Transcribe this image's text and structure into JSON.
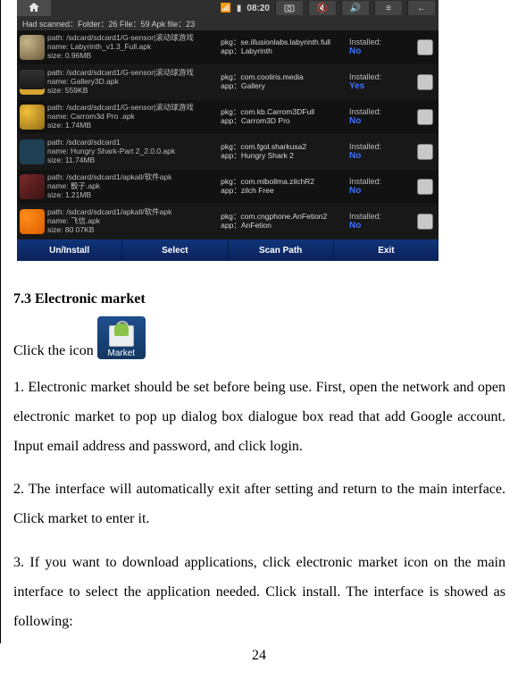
{
  "device": {
    "statusbar": {
      "home_icon": "home-icon",
      "time": "08:20"
    },
    "scan_header": "Had scanned：Folder：26  File：59  Apk file：23",
    "apks": [
      {
        "path": "path: /sdcard/sdcard1/G-sensor|滚动球游戏",
        "name": "name: Labyrinth_v1.3_Full.apk",
        "size": "size: 0.96MB",
        "pkg": "pkg：se.illusionlabs.labyrinth.full",
        "app": "app：Labyrinth",
        "installed_label": "Installed:",
        "status": "No"
      },
      {
        "path": "path: /sdcard/sdcard1/G-sensor|滚动球游戏",
        "name": "name: Gallery3D.apk",
        "size": "size: 559KB",
        "pkg": "pkg：com.cooliris.media",
        "app": "app：Gallery",
        "installed_label": "Installed:",
        "status": "Yes"
      },
      {
        "path": "path: /sdcard/sdcard1/G-sensor|滚动球游戏",
        "name": "name: Carrom3d Pro .apk",
        "size": "size: 1.74MB",
        "pkg": "pkg：com.kb.Carrom3DFull",
        "app": "app：Carrom3D Pro",
        "installed_label": "Installed:",
        "status": "No"
      },
      {
        "path": "path: /sdcard/sdcard1",
        "name": "name: Hungry Shark-Part 2_2.0.0.apk",
        "size": "size: 11.74MB",
        "pkg": "pkg：com.fgol.sharkusa2",
        "app": "app：Hungry Shark 2",
        "installed_label": "Installed:",
        "status": "No"
      },
      {
        "path": "path: /sdcard/sdcard1/apkall/软件apk",
        "name": "name: 骰子.apk",
        "size": "size: 1.21MB",
        "pkg": "pkg：com.mlbollma.zilchR2",
        "app": "app：zilch Free",
        "installed_label": "Installed:",
        "status": "No"
      },
      {
        "path": "path: /sdcard/sdcard1/apkall/软件apk",
        "name": "name: 飞信.apk",
        "size": "size: 80 07KB",
        "pkg": "pkg：com.cngphone.AnFetion2",
        "app": "app：AnFetion",
        "installed_label": "Installed:",
        "status": "No"
      }
    ],
    "bottom_buttons": [
      "Un/Install",
      "Select",
      "Scan Path",
      "Exit"
    ]
  },
  "doc": {
    "heading": "7.3 Electronic market",
    "click_text": "Click the icon",
    "market_label": "Market",
    "para1": "1. Electronic market should be set before being use. First, open the network and open electronic market to pop up dialog box dialogue box read that add Google account. Input email address and password, and click login.",
    "para2": "2. The interface will automatically exit after setting and return to the main interface. Click market to enter it.",
    "para3": "3. If you want to download applications, click electronic market icon on the main interface to select the application needed. Click install. The interface is showed as following:",
    "page_number": "24"
  }
}
